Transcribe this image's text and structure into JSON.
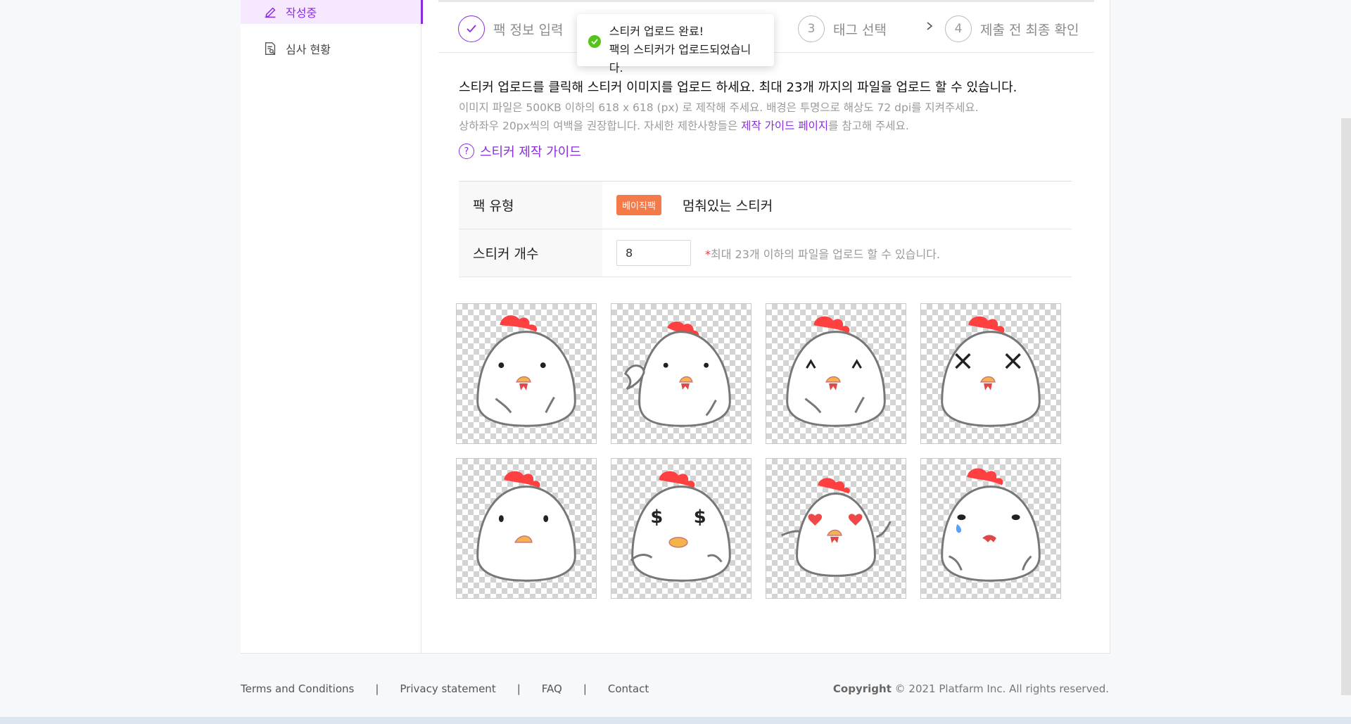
{
  "sidebar": {
    "items": [
      {
        "label": "작성중",
        "icon": "pencil-icon"
      },
      {
        "label": "심사 현황",
        "icon": "review-doc-icon"
      }
    ]
  },
  "steps": [
    {
      "num": "✓",
      "label": "팩 정보 입력",
      "state": "done"
    },
    {
      "num": "3",
      "label": "태그 선택"
    },
    {
      "num": "4",
      "label": "제출 전 최종 확인"
    }
  ],
  "toast": {
    "title": "스티커 업로드 완료!",
    "message": "팩의 스티커가 업로드되었습니다."
  },
  "description": {
    "main": "스티커 업로드를 클릭해 스티커 이미지를 업로드 하세요. 최대 23개 까지의 파일을 업로드 할 수 있습니다.",
    "sub1": "이미지 파일은 500KB 이하의 618 x 618 (px) 로 제작해 주세요. 배경은 투명으로 해상도 72 dpi를 지켜주세요.",
    "sub2_pre": "상하좌우 20px씩의 여백을 권장합니다. 자세한 제한사항들은 ",
    "sub2_link": "제작 가이드 페이지",
    "sub2_post": "를 참고해 주세요."
  },
  "guide_link": "스티커 제작 가이드",
  "form": {
    "pack_type_label": "팩 유형",
    "pack_badge": "베이직팩",
    "pack_name": "멈춰있는 스티커",
    "count_label": "스티커 개수",
    "count_value": "8",
    "count_note_star": "*",
    "count_note": "최대 23개 이하의 파일을 업로드 할 수 있습니다."
  },
  "stickers": [
    "dot-eyes-sticker",
    "waving-sticker",
    "happy-eyes-sticker",
    "x-eyes-sticker",
    "plain-sticker",
    "dollar-eyes-sticker",
    "heart-eyes-sticker",
    "crying-sticker"
  ],
  "footer": {
    "links": [
      "Terms and Conditions",
      "Privacy statement",
      "FAQ",
      "Contact"
    ],
    "copyright_bold": "Copyright",
    "copyright": " © 2021 Platfarm Inc. All rights reserved."
  },
  "colors": {
    "accent": "#8a2be2",
    "badge": "#f47a4a",
    "success": "#52c41a"
  }
}
